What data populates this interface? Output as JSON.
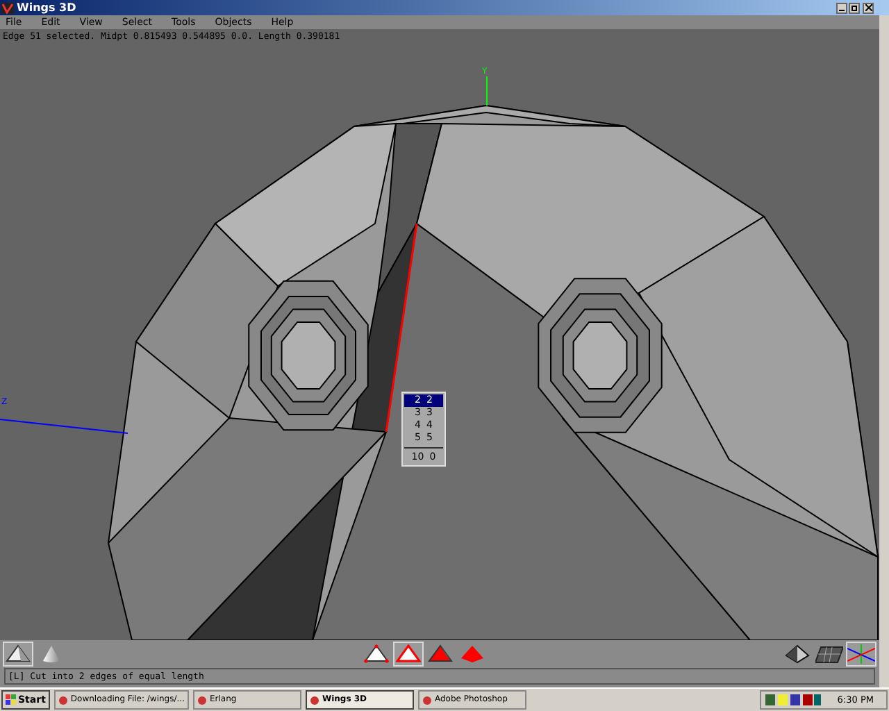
{
  "window": {
    "title": "Wings 3D"
  },
  "menu": [
    "File",
    "Edit",
    "View",
    "Select",
    "Tools",
    "Objects",
    "Help"
  ],
  "info_line": "Edge 51 selected. Midpt 0.815493 0.544895 0.0. Length 0.390181",
  "viewport": {
    "axis_labels": [
      {
        "kind": "y",
        "text": "Y"
      },
      {
        "kind": "z",
        "text": "Z"
      }
    ],
    "popup_menu": [
      {
        "kind": "item",
        "label": "2",
        "value": "2",
        "selected": true
      },
      {
        "kind": "item",
        "label": "3",
        "value": "3",
        "selected": false
      },
      {
        "kind": "item",
        "label": "4",
        "value": "4",
        "selected": false
      },
      {
        "kind": "item",
        "label": "5",
        "value": "5",
        "selected": false
      },
      {
        "kind": "separator"
      },
      {
        "kind": "item",
        "label": "10",
        "value": "0",
        "selected": false
      }
    ]
  },
  "toolbar": {
    "view_buttons": [
      {
        "kind": "smooth",
        "selected": true
      },
      {
        "kind": "shaded",
        "selected": false
      }
    ],
    "selection_modes": [
      {
        "kind": "vertex",
        "selected": false
      },
      {
        "kind": "edge",
        "selected": true
      },
      {
        "kind": "face",
        "selected": false
      },
      {
        "kind": "body",
        "selected": false
      }
    ],
    "right_buttons": [
      {
        "kind": "wire",
        "selected": false
      },
      {
        "kind": "grid",
        "selected": false
      },
      {
        "kind": "axes",
        "selected": true
      }
    ]
  },
  "status_bar": "[L] Cut into 2 edges of equal length",
  "taskbar": {
    "start": "Start",
    "tasks": [
      {
        "label": "Downloading File: /wings/...",
        "selected": false
      },
      {
        "label": "Erlang",
        "selected": false
      },
      {
        "label": "Wings 3D",
        "selected": true
      },
      {
        "label": "Adobe Photoshop",
        "selected": false
      }
    ],
    "clock": "6:30 PM"
  }
}
